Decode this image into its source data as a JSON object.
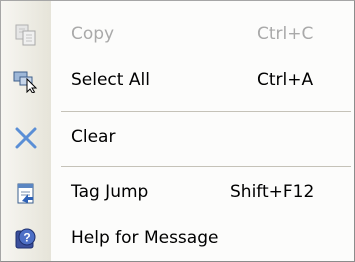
{
  "context_menu": {
    "items": [
      {
        "label": "Copy",
        "shortcut": "Ctrl+C",
        "icon": "copy-icon",
        "enabled": false
      },
      {
        "label": "Select All",
        "shortcut": "Ctrl+A",
        "icon": "select-all-icon",
        "enabled": true
      },
      {
        "label": "Clear",
        "shortcut": "",
        "icon": "clear-icon",
        "enabled": true
      },
      {
        "label": "Tag Jump",
        "shortcut": "Shift+F12",
        "icon": "tag-jump-icon",
        "enabled": true
      },
      {
        "label": "Help for Message",
        "shortcut": "",
        "icon": "help-icon",
        "enabled": true
      }
    ]
  },
  "colors": {
    "disabled_text": "#a9a9a9",
    "clear_icon": "#5b8fd6",
    "gutter": "#ece9d8"
  }
}
